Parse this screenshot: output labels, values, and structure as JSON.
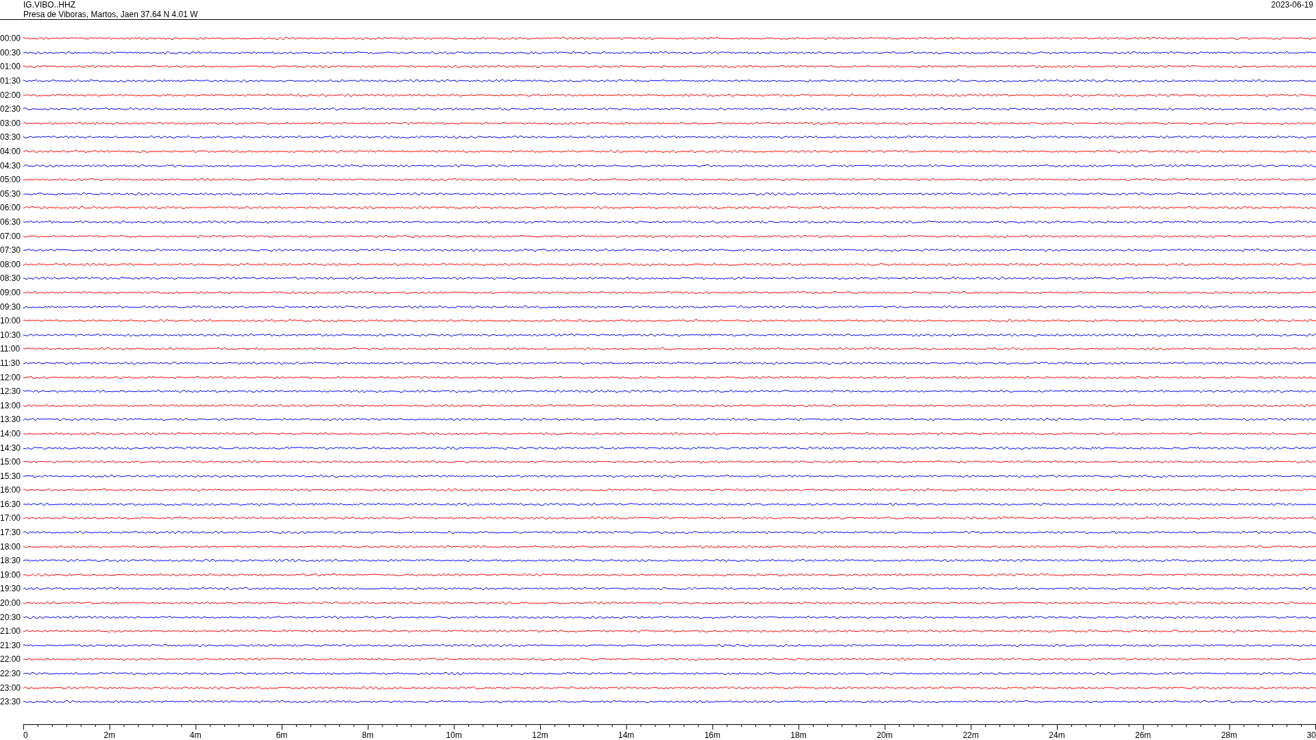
{
  "header": {
    "station": "IG.VIBO..HHZ",
    "location": "Presa de Viboras, Martos, Jaen  37.64 N 4.01 W",
    "date": "2023-06-19"
  },
  "rows": [
    {
      "time": "00:00",
      "color": "#ff0000"
    },
    {
      "time": "00:30",
      "color": "#0000ff"
    },
    {
      "time": "01:00",
      "color": "#ff0000"
    },
    {
      "time": "01:30",
      "color": "#0000ff"
    },
    {
      "time": "02:00",
      "color": "#ff0000"
    },
    {
      "time": "02:30",
      "color": "#0000ff"
    },
    {
      "time": "03:00",
      "color": "#ff0000"
    },
    {
      "time": "03:30",
      "color": "#0000ff"
    },
    {
      "time": "04:00",
      "color": "#ff0000"
    },
    {
      "time": "04:30",
      "color": "#0000ff"
    },
    {
      "time": "05:00",
      "color": "#ff0000"
    },
    {
      "time": "05:30",
      "color": "#0000ff"
    },
    {
      "time": "06:00",
      "color": "#ff0000"
    },
    {
      "time": "06:30",
      "color": "#0000ff"
    },
    {
      "time": "07:00",
      "color": "#ff0000"
    },
    {
      "time": "07:30",
      "color": "#0000ff"
    },
    {
      "time": "08:00",
      "color": "#ff0000"
    },
    {
      "time": "08:30",
      "color": "#0000ff"
    },
    {
      "time": "09:00",
      "color": "#ff0000"
    },
    {
      "time": "09:30",
      "color": "#0000ff"
    },
    {
      "time": "10:00",
      "color": "#ff0000"
    },
    {
      "time": "10:30",
      "color": "#0000ff"
    },
    {
      "time": "11:00",
      "color": "#ff0000"
    },
    {
      "time": "11:30",
      "color": "#0000ff"
    },
    {
      "time": "12:00",
      "color": "#ff0000"
    },
    {
      "time": "12:30",
      "color": "#0000ff"
    },
    {
      "time": "13:00",
      "color": "#ff0000"
    },
    {
      "time": "13:30",
      "color": "#0000ff"
    },
    {
      "time": "14:00",
      "color": "#ff0000"
    },
    {
      "time": "14:30",
      "color": "#0000ff"
    },
    {
      "time": "15:00",
      "color": "#ff0000"
    },
    {
      "time": "15:30",
      "color": "#0000ff"
    },
    {
      "time": "16:00",
      "color": "#ff0000"
    },
    {
      "time": "16:30",
      "color": "#0000ff"
    },
    {
      "time": "17:00",
      "color": "#ff0000"
    },
    {
      "time": "17:30",
      "color": "#0000ff"
    },
    {
      "time": "18:00",
      "color": "#ff0000"
    },
    {
      "time": "18:30",
      "color": "#0000ff"
    },
    {
      "time": "19:00",
      "color": "#ff0000"
    },
    {
      "time": "19:30",
      "color": "#0000ff"
    },
    {
      "time": "20:00",
      "color": "#ff0000"
    },
    {
      "time": "20:30",
      "color": "#0000ff"
    },
    {
      "time": "21:00",
      "color": "#ff0000"
    },
    {
      "time": "21:30",
      "color": "#0000ff"
    },
    {
      "time": "22:00",
      "color": "#ff0000"
    },
    {
      "time": "22:30",
      "color": "#0000ff"
    },
    {
      "time": "23:00",
      "color": "#ff0000"
    },
    {
      "time": "23:30",
      "color": "#0000ff"
    }
  ],
  "axis": {
    "labels": [
      "0",
      "2m",
      "4m",
      "6m",
      "8m",
      "10m",
      "12m",
      "14m",
      "16m",
      "18m",
      "20m",
      "22m",
      "24m",
      "26m",
      "28m",
      "30"
    ]
  }
}
